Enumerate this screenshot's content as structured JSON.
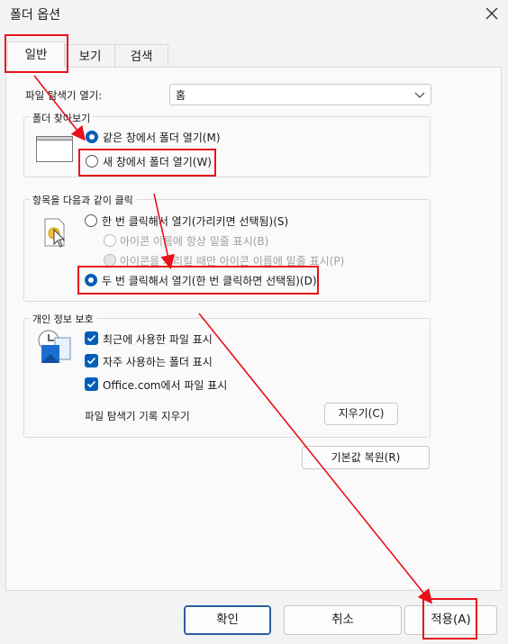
{
  "window": {
    "title": "폴더 옵션",
    "close_icon": "close-icon"
  },
  "tabs": [
    {
      "label": "일반",
      "selected": true
    },
    {
      "label": "보기",
      "selected": false
    },
    {
      "label": "검색",
      "selected": false
    }
  ],
  "general": {
    "open_explorer_label": "파일 탐색기 열기:",
    "open_explorer_value": "홈",
    "browse": {
      "title": "폴더 찾아보기",
      "options": [
        {
          "label": "같은 창에서 폴더 열기(M)",
          "checked": true
        },
        {
          "label": "새 창에서 폴더 열기(W)",
          "checked": false
        }
      ]
    },
    "click": {
      "title": "항목을 다음과 같이 클릭",
      "single_click": {
        "label": "한 번 클릭해서 열기(가리키면 선택됨)(S)",
        "checked": false
      },
      "sub_options": [
        {
          "label": "아이콘 이름에 항상 밑줄 표시(B)",
          "disabled": true
        },
        {
          "label": "아이콘을 가리킬 때만 아이콘 이름에 밑줄 표시(P)",
          "disabled": true
        }
      ],
      "double_click": {
        "label": "두 번 클릭해서 열기(한 번 클릭하면 선택됨)(D)",
        "checked": true
      }
    },
    "privacy": {
      "title": "개인 정보 보호",
      "checks": [
        {
          "label": "최근에 사용한 파일 표시",
          "checked": true
        },
        {
          "label": "자주 사용하는 폴더 표시",
          "checked": true
        },
        {
          "label": "Office.com에서 파일 표시",
          "checked": true
        }
      ],
      "clear_history_label": "파일 탐색기 기록 지우기",
      "clear_button": "지우기(C)"
    },
    "restore_defaults_button": "기본값 복원(R)"
  },
  "footer": {
    "ok": "확인",
    "cancel": "취소",
    "apply": "적용(A)"
  },
  "annotation_color": "#e8111a"
}
